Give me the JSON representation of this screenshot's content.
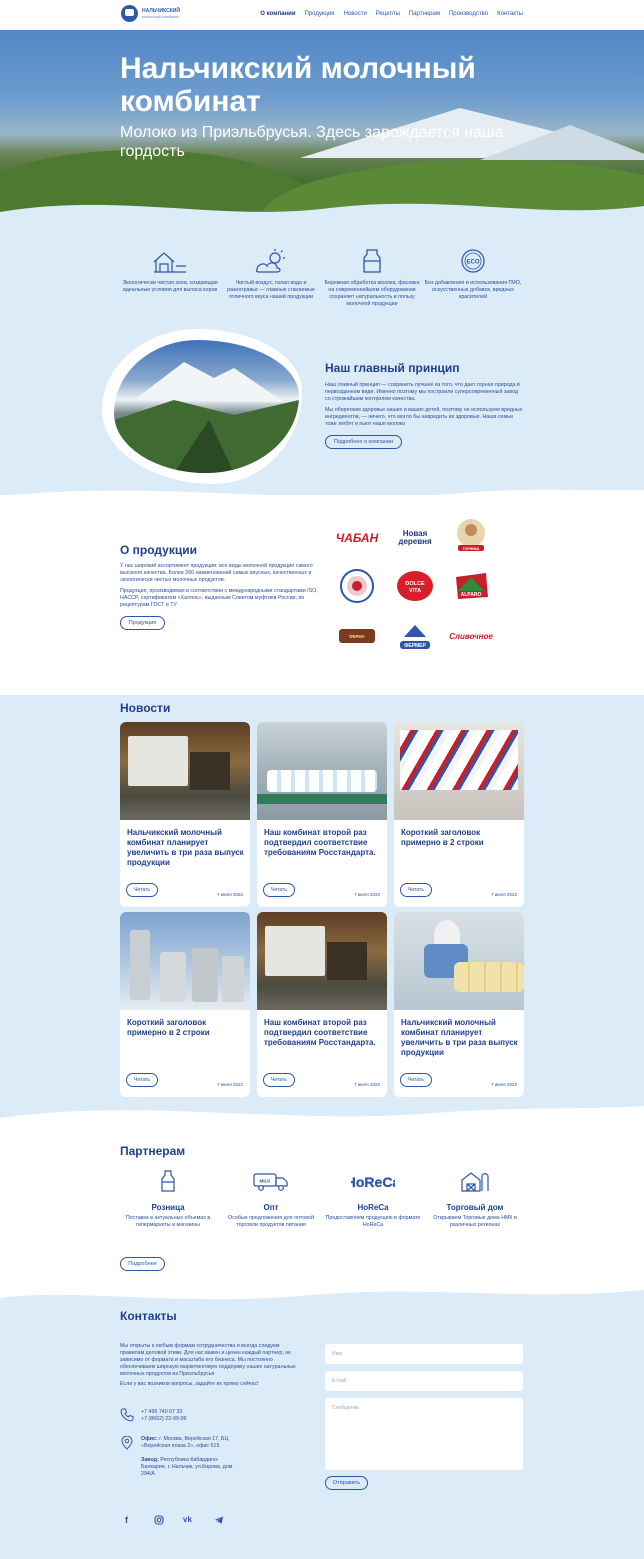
{
  "header": {
    "logo_line1": "НАЛЬЧИКСКИЙ",
    "logo_line2": "молочный комбинат",
    "nav": [
      "О компании",
      "Продукция",
      "Новости",
      "Рецепты",
      "Партнерам",
      "Производство",
      "Контакты"
    ]
  },
  "hero": {
    "title": "Нальчикский молочный комбинат",
    "subtitle": "Молоко из Приэльбрусья. Здесь зарождается наша гордость"
  },
  "features": [
    {
      "icon": "farm-icon",
      "text": "Экологически чистая зона, создающая идеальные условия для выпаса коров"
    },
    {
      "icon": "weather-icon",
      "text": "Чистый воздух, талая вода и разнотравье — главные слагаемые отличного вкуса нашей продукции"
    },
    {
      "icon": "milk-can-icon",
      "text": "Бережная обработка молока, фасовка на современнейшем оборудовании сохраняет натуральность и пользу молочной продукции"
    },
    {
      "icon": "eco-icon",
      "text": "Без добавления и использования ГМО, искусственных добавок, вредных красителей"
    }
  ],
  "principle": {
    "title": "Наш главный принцип",
    "p1": "Наш главный принцип — сохранить лучшее из того, что дает горная природа в первозданном виде. Именно поэтому мы построили суперсовременный завод со строжайшим контролем качества.",
    "p2": "Мы оберегаем здоровье наших и ваших детей, поэтому не используем вредных ингредиентов, — ничего, что могло бы навредить их здоровью. Наши семьи тоже любят и пьют наше молоко",
    "button": "Подробнее о компании"
  },
  "products": {
    "title": "О продукции",
    "p1": "У нас широкий ассортимент продукции: все виды молочной продукции самого высокого качества. Более 200 наименований самых вкусных, качественных и экологически чистых молочных продуктов.",
    "p2": "Продукция, производимая в соответствии с международными стандартами ISO, HACCP, сертификатом «Халяль», выданным Советом муфтиев России, по рецептурам ГОСТ и ТУ",
    "button": "Продукция",
    "brands": [
      "ЧАБАН",
      "Новая деревня",
      "ГОРЯНКА",
      "",
      "DOLCE VITA",
      "ALPARO",
      "Кабардинская Ферма",
      "ФЕРМЕР",
      "Сливочное"
    ]
  },
  "news": {
    "title": "Новости",
    "read": "Читать",
    "items": [
      {
        "title": "Нальчикский молочный комбинат планирует увеличить в три раза выпуск продукции",
        "date": "7 июля 2022"
      },
      {
        "title": "Наш комбинат второй раз подтвердил соответствие требованиям Росстандарта.",
        "date": "7 июля 2022"
      },
      {
        "title": "Короткий заголовок примерно в 2 строки",
        "date": "7 июля 2022"
      },
      {
        "title": "Короткий заголовок примерно в 2 строки",
        "date": "7 июля 2022"
      },
      {
        "title": "Наш комбинат второй раз подтвердил соответствие требованиям Росстандарта.",
        "date": "7 июля 2022"
      },
      {
        "title": "Нальчикский молочный комбинат планирует увеличить в три раза выпуск продукции",
        "date": "7 июля 2022"
      }
    ]
  },
  "partners": {
    "title": "Партнерам",
    "items": [
      {
        "icon": "milk-bottle-icon",
        "title": "Розница",
        "text": "Поставка в актуальных объемах в гипермаркеты и магазины"
      },
      {
        "icon": "milk-truck-icon",
        "title": "Опт",
        "text": "Особые предложения для оптовой торговли продуктов питания"
      },
      {
        "icon": "horeca-icon",
        "title": "HoReCa",
        "text": "Предоставляем продукцию в формате HoReCa"
      },
      {
        "icon": "barn-icon",
        "title": "Торговый дом",
        "text": "Открываем Торговые дома НМК в различных регионах"
      }
    ],
    "button": "Подробнее"
  },
  "contacts": {
    "title": "Контакты",
    "p1": "Мы открыты к любым формам сотрудничества и всегда следуем правилам деловой этики. Для нас важен и ценен каждый партнер, не зависимо от формата и масштаба его бизнеса. Мы постоянно обеспечиваем широкую маркетинговую поддержку наших натуральных молочных продуктов из Приэльбрусья",
    "p2": "Если у вас возникли вопросы, задайте их прямо сейчас!",
    "phone1": "+7 495 740 07 32",
    "phone2": "+7 (8662) 22-99-99",
    "office_label": "Офис:",
    "office": "г. Москва, Верейская 17, БЦ «Верейская плаза 2», офис 515",
    "plant_label": "Завод:",
    "plant": "Республика Кабардино-Балкария, г. Нальчик, ул.Кирова, дом 294/А",
    "name_placeholder": "Имя",
    "email_placeholder": "E-mail",
    "message_placeholder": "Сообщение",
    "send": "Отправить",
    "socials": [
      "f",
      "ig",
      "vk",
      "tg"
    ]
  }
}
